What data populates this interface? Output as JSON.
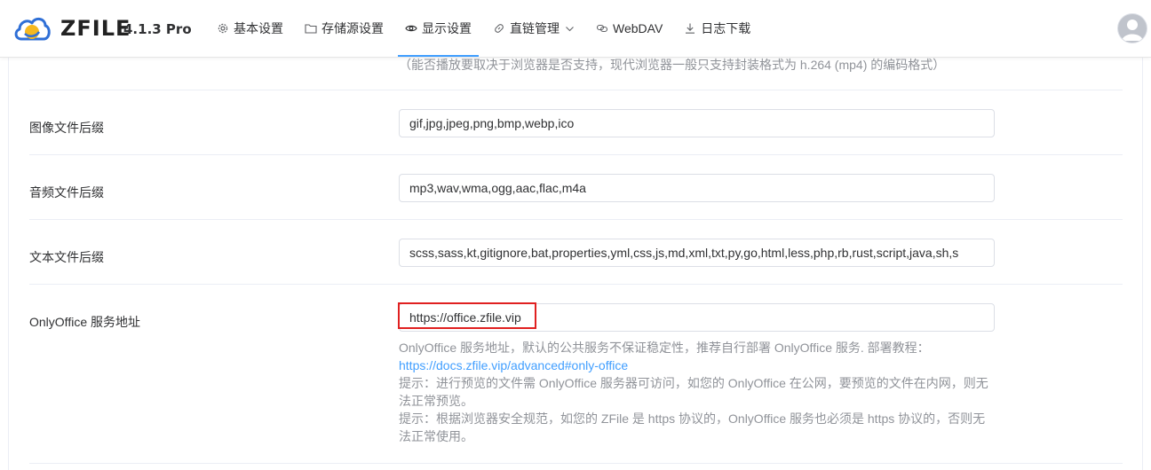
{
  "header": {
    "brand": "ZFILE",
    "version": "4.1.3 Pro",
    "nav": [
      {
        "label": "基本设置",
        "icon": "gear-icon"
      },
      {
        "label": "存储源设置",
        "icon": "folder-icon"
      },
      {
        "label": "显示设置",
        "icon": "eye-icon",
        "active": true
      },
      {
        "label": "直链管理",
        "icon": "link-icon",
        "dropdown": true
      },
      {
        "label": "WebDAV",
        "icon": "webdav-icon"
      },
      {
        "label": "日志下载",
        "icon": "download-icon"
      }
    ],
    "accent_color": "#409eff"
  },
  "form": {
    "video_hint": "（能否播放要取决于浏览器是否支持，现代浏览器一般只支持封装格式为 h.264 (mp4) 的编码格式）",
    "image_suffix": {
      "label": "图像文件后缀",
      "value": "gif,jpg,jpeg,png,bmp,webp,ico"
    },
    "audio_suffix": {
      "label": "音频文件后缀",
      "value": "mp3,wav,wma,ogg,aac,flac,m4a"
    },
    "text_suffix": {
      "label": "文本文件后缀",
      "value": "scss,sass,kt,gitignore,bat,properties,yml,css,js,md,xml,txt,py,go,html,less,php,rb,rust,script,java,sh,s"
    },
    "onlyoffice": {
      "label": "OnlyOffice 服务地址",
      "value": "https://office.zfile.vip",
      "hint_line1": "OnlyOffice 服务地址，默认的公共服务不保证稳定性，推荐自行部署 OnlyOffice 服务. 部署教程：",
      "hint_link": "https://docs.zfile.vip/advanced#only-office",
      "hint_line3": "提示：进行预览的文件需 OnlyOffice 服务器可访问，如您的 OnlyOffice 在公网，要预览的文件在内网，则无",
      "hint_line4": "法正常预览。",
      "hint_line5": "提示：根据浏览器安全规范，如您的 ZFile 是 https 协议的，OnlyOffice 服务也必须是 https 协议的，否则无",
      "hint_line6": "法正常使用。"
    },
    "highlight_color": "#e02020"
  }
}
